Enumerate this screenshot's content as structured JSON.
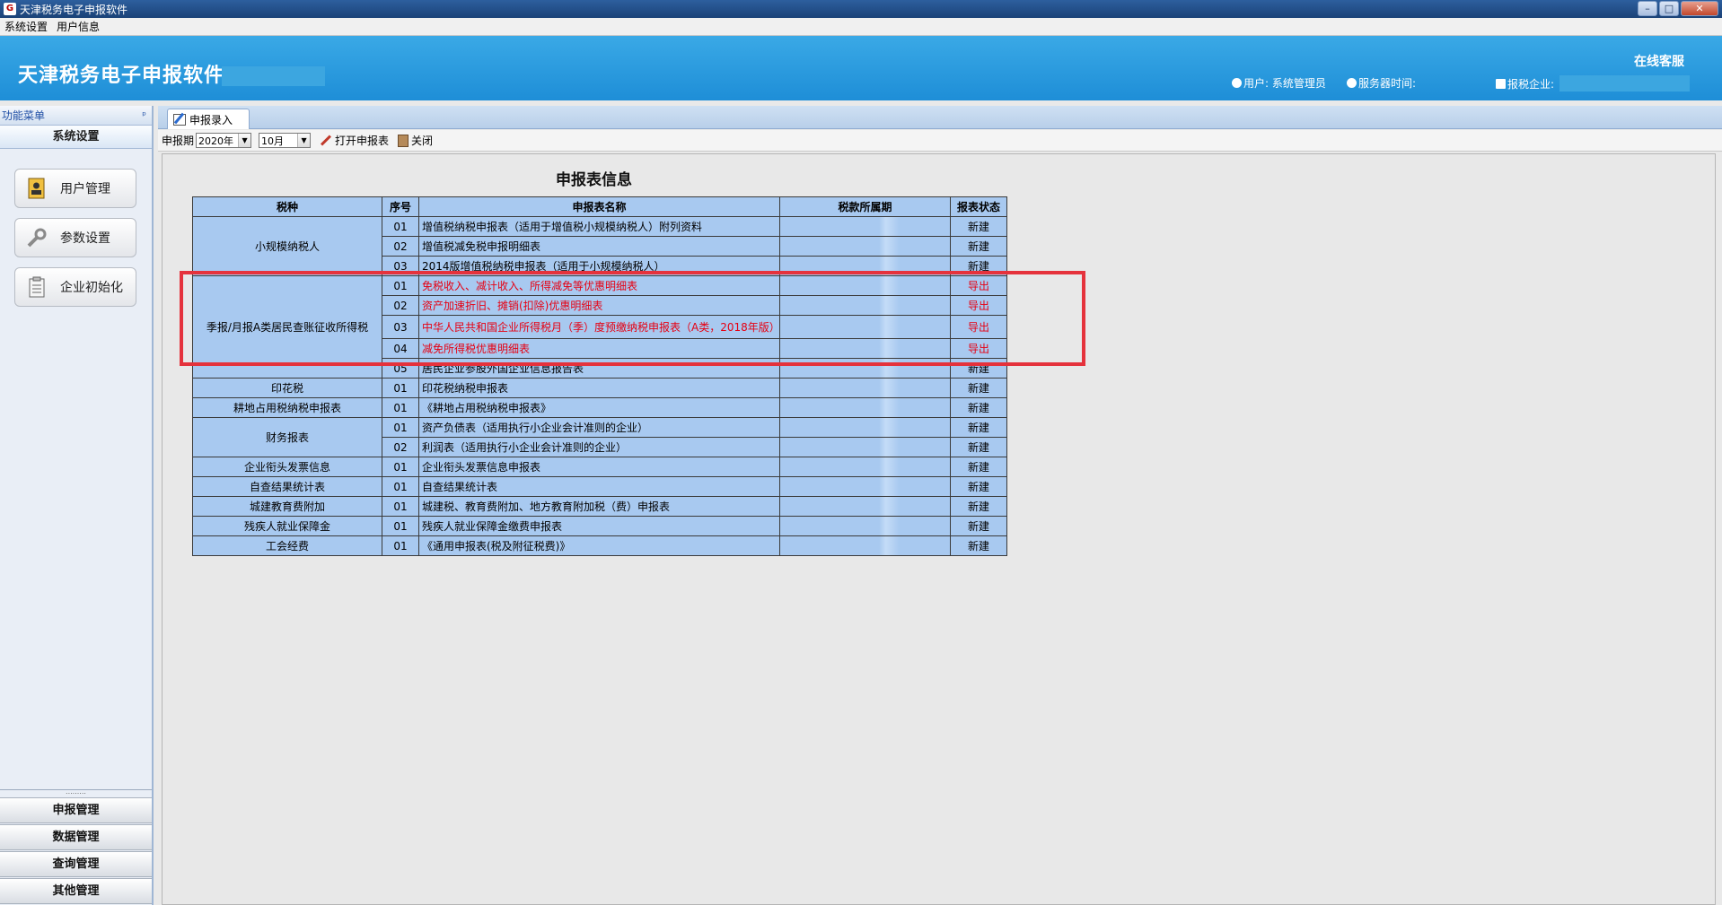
{
  "window": {
    "title": "天津税务电子申报软件"
  },
  "menubar": {
    "items": [
      "系统设置",
      "用户信息"
    ]
  },
  "header": {
    "app_title": "天津税务电子申报软件",
    "online_service": "在线客服",
    "user_label": "用户: 系统管理员",
    "server_time_label": "服务器时间:",
    "taxpayer_label": "报税企业:"
  },
  "sidebar": {
    "header": "功能菜单",
    "pin": "ᵖ",
    "section": "系统设置",
    "tools": [
      {
        "label": "用户管理",
        "icon": "user-card-icon"
      },
      {
        "label": "参数设置",
        "icon": "wrench-icon"
      },
      {
        "label": "企业初始化",
        "icon": "clipboard-icon"
      }
    ],
    "bottom": [
      "申报管理",
      "数据管理",
      "查询管理",
      "其他管理"
    ]
  },
  "tab": {
    "label": "申报录入"
  },
  "toolbar": {
    "period_label": "申报期",
    "year": "2020年",
    "month": "10月",
    "open_label": "打开申报表",
    "close_label": "关闭"
  },
  "page": {
    "title": "申报表信息",
    "columns": [
      "税种",
      "序号",
      "申报表名称",
      "税款所属期",
      "报表状态"
    ]
  },
  "table": {
    "groups": [
      {
        "category": "小规模纳税人",
        "rows": [
          {
            "seq": "01",
            "name": "增值税纳税申报表（适用于增值税小规模纳税人）附列资料",
            "status": "新建",
            "red": false
          },
          {
            "seq": "02",
            "name": "增值税减免税申报明细表",
            "status": "新建",
            "red": false
          },
          {
            "seq": "03",
            "name": "2014版增值税纳税申报表（适用于小规模纳税人）",
            "status": "新建",
            "red": false
          }
        ]
      },
      {
        "category": "季报/月报A类居民查账征收所得税",
        "rows": [
          {
            "seq": "01",
            "name": "免税收入、减计收入、所得减免等优惠明细表",
            "status": "导出",
            "red": true
          },
          {
            "seq": "02",
            "name": "资产加速折旧、摊销(扣除)优惠明细表",
            "status": "导出",
            "red": true
          },
          {
            "seq": "03",
            "name": "中华人民共和国企业所得税月（季）度预缴纳税申报表（A类，2018年版）",
            "status": "导出",
            "red": true,
            "tall": true
          },
          {
            "seq": "04",
            "name": "减免所得税优惠明细表",
            "status": "导出",
            "red": true
          },
          {
            "seq": "05",
            "name": "居民企业参股外国企业信息报告表",
            "status": "新建",
            "red": false
          }
        ]
      },
      {
        "category": "印花税",
        "rows": [
          {
            "seq": "01",
            "name": "印花税纳税申报表",
            "status": "新建",
            "red": false
          }
        ]
      },
      {
        "category": "耕地占用税纳税申报表",
        "rows": [
          {
            "seq": "01",
            "name": "《耕地占用税纳税申报表》",
            "status": "新建",
            "red": false
          }
        ]
      },
      {
        "category": "财务报表",
        "rows": [
          {
            "seq": "01",
            "name": "资产负债表（适用执行小企业会计准则的企业）",
            "status": "新建",
            "red": false
          },
          {
            "seq": "02",
            "name": "利润表（适用执行小企业会计准则的企业）",
            "status": "新建",
            "red": false
          }
        ]
      },
      {
        "category": "企业衔头发票信息",
        "rows": [
          {
            "seq": "01",
            "name": "企业衔头发票信息申报表",
            "status": "新建",
            "red": false
          }
        ]
      },
      {
        "category": "自查结果统计表",
        "rows": [
          {
            "seq": "01",
            "name": "自查结果统计表",
            "status": "新建",
            "red": false
          }
        ]
      },
      {
        "category": "城建教育费附加",
        "rows": [
          {
            "seq": "01",
            "name": "城建税、教育费附加、地方教育附加税（费）申报表",
            "status": "新建",
            "red": false
          }
        ]
      },
      {
        "category": "残疾人就业保障金",
        "rows": [
          {
            "seq": "01",
            "name": "残疾人就业保障金缴费申报表",
            "status": "新建",
            "red": false
          }
        ]
      },
      {
        "category": "工会经费",
        "rows": [
          {
            "seq": "01",
            "name": "《通用申报表(税及附征税费)》",
            "status": "新建",
            "red": false
          }
        ]
      }
    ]
  },
  "colors": {
    "header_blue": "#1e8ed7",
    "table_blue": "#a8c9f0",
    "alert_red": "#e60012",
    "highlight_red": "#e5323c"
  }
}
